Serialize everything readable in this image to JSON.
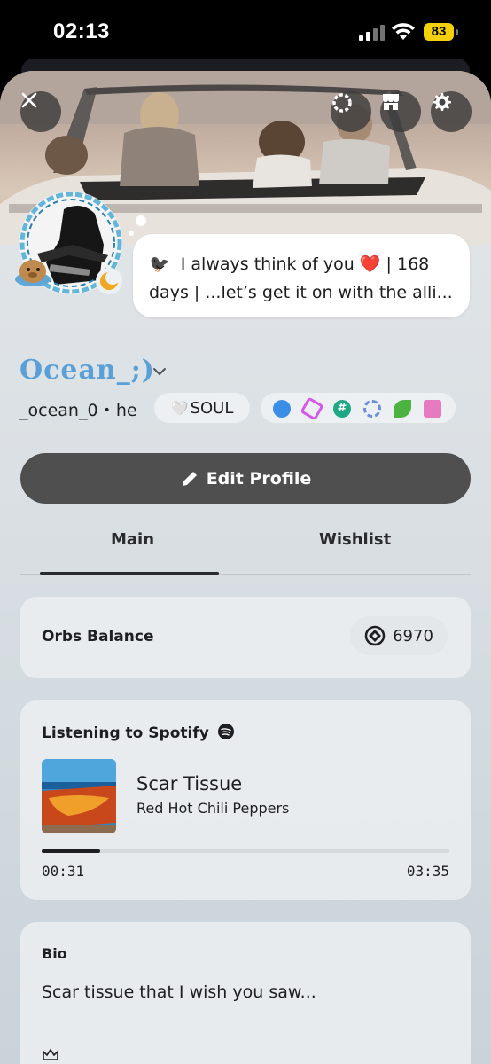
{
  "status_bar": {
    "time": "02:13",
    "battery": "83"
  },
  "profile": {
    "status_emoji": "🐦‍⬛",
    "custom_status": "I always think of you ❤️ | 168 days | ...let’s get it on with the alli...",
    "display_name": "Ocean_;)",
    "username": "_ocean_0",
    "separator": "•",
    "pronouns": "he",
    "tag": "SOUL",
    "tag_icon": "🤍"
  },
  "badges": [
    "nitro-badge",
    "boost-badge",
    "hypesquad-badge",
    "quest-badge",
    "leaf-badge",
    "gift-badge"
  ],
  "actions": {
    "edit_profile": "Edit Profile"
  },
  "tabs": [
    {
      "label": "Main"
    },
    {
      "label": "Wishlist"
    }
  ],
  "orbs": {
    "label": "Orbs Balance",
    "value": "6970"
  },
  "spotify": {
    "label": "Listening to Spotify",
    "track": "Scar Tissue",
    "artist": "Red Hot Chili Peppers",
    "elapsed": "00:31",
    "duration": "03:35",
    "progress_fraction": 0.144
  },
  "bio": {
    "label": "Bio",
    "text": "Scar tissue that I wish you saw..."
  },
  "colors": {
    "accent_name": "#5a9fd6",
    "button_bg": "#4f4f50",
    "battery": "#f4d00b"
  }
}
